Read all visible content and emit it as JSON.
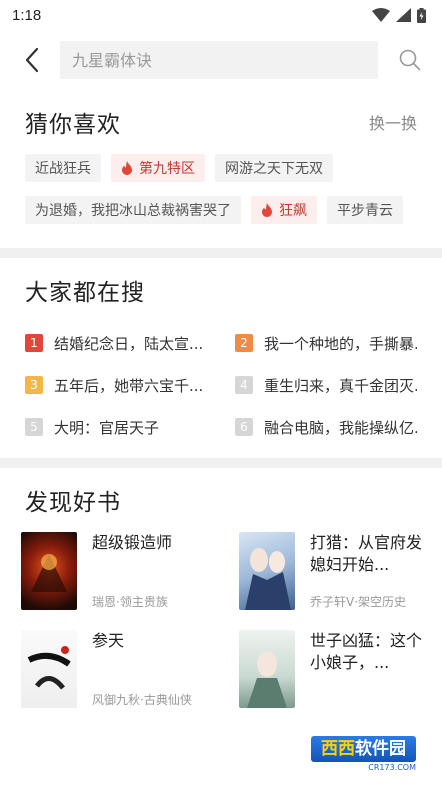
{
  "status_bar": {
    "time": "1:18"
  },
  "search": {
    "placeholder": "九星霸体诀"
  },
  "guess_you_like": {
    "title": "猜你喜欢",
    "refresh_label": "换一换",
    "tags": [
      {
        "label": "近战狂兵",
        "hot": false
      },
      {
        "label": "第九特区",
        "hot": true
      },
      {
        "label": "网游之天下无双",
        "hot": false
      },
      {
        "label": "为退婚，我把冰山总裁祸害哭了",
        "hot": false
      },
      {
        "label": "狂飙",
        "hot": true
      },
      {
        "label": "平步青云",
        "hot": false
      }
    ]
  },
  "trending": {
    "title": "大家都在搜",
    "items": [
      {
        "rank": "1",
        "title": "结婚纪念日，陆太宣...",
        "color": "#e0473a"
      },
      {
        "rank": "2",
        "title": "我一个种地的，手撕暴...",
        "color": "#ef8b46"
      },
      {
        "rank": "3",
        "title": "五年后，她带六宝千...",
        "color": "#f3b64b"
      },
      {
        "rank": "4",
        "title": "重生归来，真千金团灭...",
        "color": "#d6d6d6"
      },
      {
        "rank": "5",
        "title": "大明：官居天子",
        "color": "#d6d6d6"
      },
      {
        "rank": "6",
        "title": "融合电脑，我能操纵亿...",
        "color": "#d6d6d6"
      }
    ]
  },
  "discover": {
    "title": "发现好书",
    "books": [
      {
        "title": "超级锻造师",
        "meta": "瑞恩·领主贵族",
        "cover_text": "超级锻造师"
      },
      {
        "title": "打猎：从官府发媳妇开始...",
        "meta": "乔子轩V·架空历史",
        "cover_text": "从官府发媳妇"
      },
      {
        "title": "参天",
        "meta": "风御九秋·古典仙侠",
        "cover_text": "参天"
      },
      {
        "title": "世子凶猛：这个小娘子，...",
        "meta": "",
        "cover_text": ""
      }
    ]
  },
  "watermark": {
    "main_a": "西西",
    "main_b": "软件园",
    "sub": "CR173.COM"
  }
}
